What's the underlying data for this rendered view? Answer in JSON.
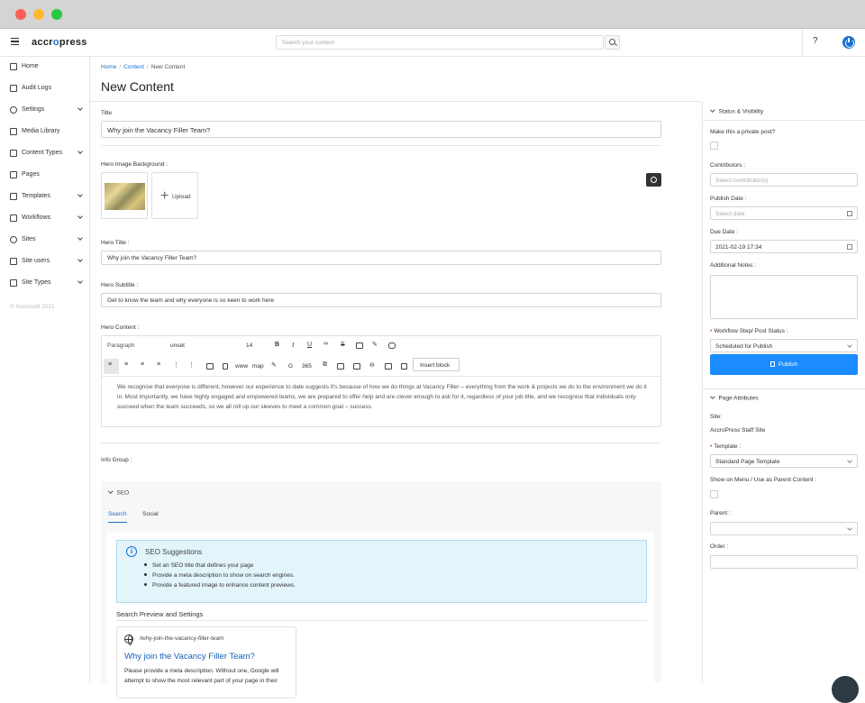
{
  "window": {
    "title": ""
  },
  "header": {
    "logo_prefix": "accr",
    "logo_accent": "o",
    "logo_suffix": "press",
    "search_placeholder": "Search your content",
    "help": "?"
  },
  "sidebar": {
    "items": [
      {
        "label": "Home",
        "icon": "home-icon",
        "has_chevron": false
      },
      {
        "label": "Audit Logs",
        "icon": "clipboard-icon",
        "has_chevron": false
      },
      {
        "label": "Settings",
        "icon": "settings-icon",
        "has_chevron": true
      },
      {
        "label": "Media Library",
        "icon": "image-icon",
        "has_chevron": false
      },
      {
        "label": "Content Types",
        "icon": "content-types-icon",
        "has_chevron": true
      },
      {
        "label": "Pages",
        "icon": "page-icon",
        "has_chevron": false
      },
      {
        "label": "Templates",
        "icon": "template-icon",
        "has_chevron": true
      },
      {
        "label": "Workflows",
        "icon": "workflow-icon",
        "has_chevron": true
      },
      {
        "label": "Sites",
        "icon": "globe-icon",
        "has_chevron": true
      },
      {
        "label": "Site users",
        "icon": "user-icon",
        "has_chevron": true
      },
      {
        "label": "Site Types",
        "icon": "site-types-icon",
        "has_chevron": true
      }
    ],
    "copyright": "© Accrosoft 2021"
  },
  "breadcrumb": {
    "home": "Home",
    "content": "Content",
    "current": "New Content"
  },
  "page_title": "New Content",
  "form": {
    "title_label": "Title",
    "title_value": "Why join the Vacancy Filler Team?",
    "hero_bg_label": "Hero Image Background :",
    "upload_label": "Upload",
    "hero_title_label": "Hero Title :",
    "hero_title_value": "Why join the Vacancy Filler Team?",
    "hero_subtitle_label": "Hero Subtitle :",
    "hero_subtitle_value": "Get to know the team and why everyone is so keen to work here",
    "hero_content_label": "Hero Content :",
    "editor": {
      "block_type": "Paragraph",
      "font": "unset",
      "size": "14",
      "www": "www",
      "map": "map",
      "g": "G",
      "n365": "365",
      "insert_block": "Insert block",
      "content": "We recognise that everyone is different, however our experience to date suggests it's because of how we do things at Vacancy Filler – everything from the work & projects we do to the environment we do it in. Most importantly, we have highly engaged and empowered teams, we are prepared to offer help and are clever enough to ask for it, regardless of your job title, and we recognise that individuals only succeed when the team succeeds, so we all roll up our sleeves to meet a common goal – success."
    },
    "info_group_label": "Info Group :"
  },
  "seo": {
    "header": "SEO",
    "tabs": [
      "Search",
      "Social"
    ],
    "alert_title": "SEO Suggestions",
    "suggestions": [
      "Set an SEO title that defines your page",
      "Provide a meta description to show on search engines.",
      "Provide a featured image to enhance content previews."
    ],
    "preview_title": "Search Preview and Settings",
    "preview_url": "/why-join-the-vacancy-filler-team",
    "preview_link": "Why join the Vacancy Filler Team?",
    "preview_desc": "Please provide a meta description. Without one, Google will attempt to show the most relevant part of your page in their"
  },
  "status": {
    "header": "Status & Visibility",
    "private_label": "Make this a private post?",
    "contributors_label": "Contributors :",
    "contributors_placeholder": "Select contributor(s)",
    "publish_date_label": "Publish Date :",
    "publish_date_placeholder": "Select date",
    "due_date_label": "Due Date :",
    "due_date_value": "2021-02-19 17:34",
    "notes_label": "Additional Notes :",
    "workflow_label": "Workflow Step/ Post Status :",
    "workflow_value": "Scheduled for Publish",
    "publish_button": "Publish"
  },
  "page_attributes": {
    "header": "Page Attributes",
    "site_label": "Site:",
    "site_value": "AccroPress Staff Site",
    "template_label": "Template :",
    "template_value": "Standard Page Template",
    "show_menu_label": "Show on Menu / Use as Parent Content :",
    "parent_label": "Parent :",
    "order_label": "Order :"
  },
  "colors": {
    "accent": "#1a73c9",
    "publish": "#1a8cff",
    "alert_bg": "#e3f4fb"
  }
}
